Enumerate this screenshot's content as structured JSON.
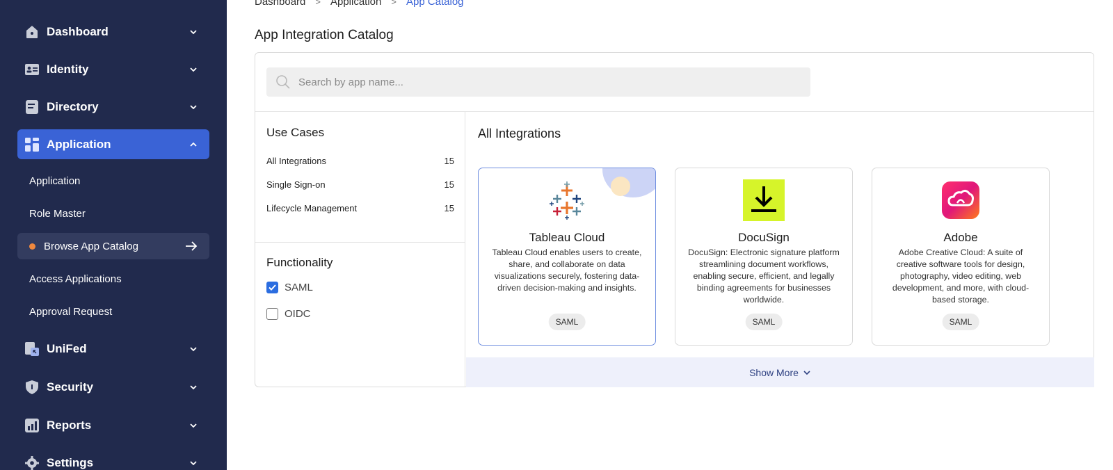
{
  "sidebar": {
    "items": [
      {
        "label": "Dashboard",
        "icon": "home-icon"
      },
      {
        "label": "Identity",
        "icon": "id-card-icon"
      },
      {
        "label": "Directory",
        "icon": "directory-icon"
      },
      {
        "label": "Application",
        "icon": "app-grid-icon"
      },
      {
        "label": "UniFed",
        "icon": "unifed-icon"
      },
      {
        "label": "Security",
        "icon": "shield-icon"
      },
      {
        "label": "Reports",
        "icon": "chart-icon"
      },
      {
        "label": "Settings",
        "icon": "gear-icon"
      }
    ],
    "sub_items": [
      {
        "label": "Application"
      },
      {
        "label": "Role Master"
      },
      {
        "label": "Browse App Catalog"
      },
      {
        "label": "Access Applications"
      },
      {
        "label": "Approval Request"
      }
    ],
    "colors": {
      "background": "#212a4d",
      "active": "#3a63d6",
      "current_dot": "#f0883e"
    }
  },
  "breadcrumb": {
    "items": [
      "Dashboard",
      "Application",
      "App Catalog"
    ]
  },
  "page": {
    "title": "App Integration Catalog"
  },
  "search": {
    "placeholder": "Search by app name..."
  },
  "filters": {
    "use_cases_title": "Use Cases",
    "use_cases": [
      {
        "label": "All Integrations",
        "count": "15"
      },
      {
        "label": "Single Sign-on",
        "count": "15"
      },
      {
        "label": "Lifecycle Management",
        "count": "15"
      }
    ],
    "functionality_title": "Functionality",
    "functionality": [
      {
        "label": "SAML",
        "checked": true
      },
      {
        "label": "OIDC",
        "checked": false
      }
    ]
  },
  "integrations": {
    "title": "All Integrations",
    "apps": [
      {
        "name": "Tableau Cloud",
        "icon": "tableau-logo",
        "description": "Tableau Cloud enables users to create, share, and collaborate on data visualizations securely, fostering data-driven decision-making and insights.",
        "badge": "SAML"
      },
      {
        "name": "DocuSign",
        "icon": "docusign-logo",
        "description": "DocuSign: Electronic signature platform streamlining document workflows, enabling secure, efficient, and legally binding agreements for businesses worldwide.",
        "badge": "SAML"
      },
      {
        "name": "Adobe",
        "icon": "adobe-logo",
        "description": "Adobe Creative Cloud: A suite of creative software tools for design, photography, video editing, web development, and more, with cloud-based storage.",
        "badge": "SAML"
      }
    ],
    "show_more": "Show More"
  }
}
